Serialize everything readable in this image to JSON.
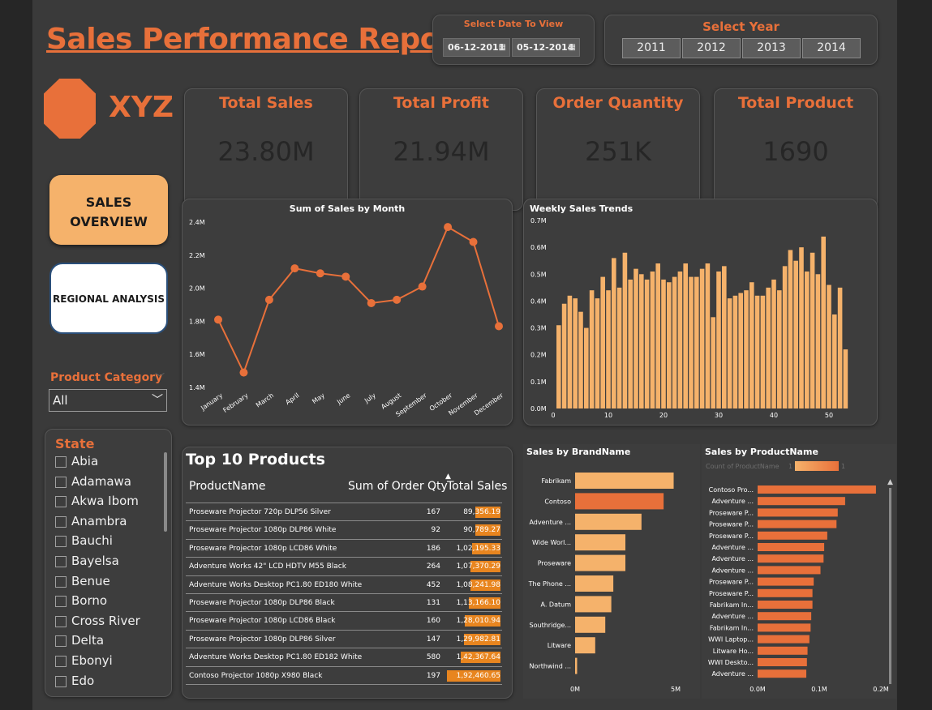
{
  "title": "Sales Performance Report",
  "date_filter": {
    "label": "Select Date To View",
    "start": "06-12-2011",
    "end": "05-12-2014"
  },
  "year_filter": {
    "label": "Select Year",
    "years": [
      "2011",
      "2012",
      "2013",
      "2014"
    ]
  },
  "logo": {
    "text": "XYZ"
  },
  "kpis": [
    {
      "title": "Total Sales",
      "value": "23.80M"
    },
    {
      "title": "Total Profit",
      "value": "21.94M"
    },
    {
      "title": "Order Quantity",
      "value": "251K"
    },
    {
      "title": "Total Product",
      "value": "1690"
    }
  ],
  "nav": {
    "sales_overview_line1": "SALES",
    "sales_overview_line2": "OVERVIEW",
    "regional_analysis": "REGIONAL ANALYSIS"
  },
  "product_category": {
    "label": "Product Category",
    "selected": "All"
  },
  "state_filter": {
    "label": "State",
    "items": [
      "Abia",
      "Adamawa",
      "Akwa Ibom",
      "Anambra",
      "Bauchi",
      "Bayelsa",
      "Benue",
      "Borno",
      "Cross River",
      "Delta",
      "Ebonyi",
      "Edo"
    ]
  },
  "colors": {
    "accent": "#e8703a",
    "bar_light": "#f5b26b",
    "highlight": "#e8851f",
    "background": "#3a3a3a"
  },
  "chart_data": [
    {
      "type": "line",
      "title": "Sum of Sales by Month",
      "categories": [
        "January",
        "February",
        "March",
        "April",
        "May",
        "June",
        "July",
        "August",
        "September",
        "October",
        "November",
        "December"
      ],
      "values": [
        1.81,
        1.49,
        1.93,
        2.12,
        2.09,
        2.07,
        1.91,
        1.93,
        2.01,
        2.37,
        2.28,
        1.77
      ],
      "unit": "M",
      "ylim": [
        1.4,
        2.4
      ],
      "yticks": [
        "1.4M",
        "1.6M",
        "1.8M",
        "2.0M",
        "2.2M",
        "2.4M"
      ]
    },
    {
      "type": "bar",
      "title": "Weekly Sales Trends",
      "x": [
        1,
        2,
        3,
        4,
        5,
        6,
        7,
        8,
        9,
        10,
        11,
        12,
        13,
        14,
        15,
        16,
        17,
        18,
        19,
        20,
        21,
        22,
        23,
        24,
        25,
        26,
        27,
        28,
        29,
        30,
        31,
        32,
        33,
        34,
        35,
        36,
        37,
        38,
        39,
        40,
        41,
        42,
        43,
        44,
        45,
        46,
        47,
        48,
        49,
        50,
        51,
        52,
        53
      ],
      "values": [
        0.31,
        0.39,
        0.42,
        0.41,
        0.36,
        0.3,
        0.44,
        0.41,
        0.49,
        0.44,
        0.56,
        0.45,
        0.58,
        0.48,
        0.52,
        0.5,
        0.48,
        0.51,
        0.54,
        0.48,
        0.47,
        0.49,
        0.51,
        0.54,
        0.49,
        0.49,
        0.52,
        0.54,
        0.34,
        0.51,
        0.53,
        0.41,
        0.42,
        0.43,
        0.44,
        0.47,
        0.42,
        0.42,
        0.45,
        0.48,
        0.44,
        0.53,
        0.59,
        0.55,
        0.6,
        0.51,
        0.58,
        0.5,
        0.64,
        0.46,
        0.35,
        0.45,
        0.22
      ],
      "unit": "M",
      "ylim": [
        0,
        0.7
      ],
      "yticks": [
        "0.0M",
        "0.1M",
        "0.2M",
        "0.3M",
        "0.4M",
        "0.5M",
        "0.6M",
        "0.7M"
      ],
      "xticks": [
        "0",
        "10",
        "20",
        "30",
        "40",
        "50"
      ]
    },
    {
      "type": "table",
      "title": "Top 10 Products",
      "columns": [
        "ProductName",
        "Sum of Order Qty",
        "Total Sales"
      ],
      "rows": [
        {
          "product": "Proseware Projector 720p DLP56 Silver",
          "qty": "167",
          "sales": "89,356.19",
          "value": 89356.19
        },
        {
          "product": "Proseware Projector 1080p DLP86 White",
          "qty": "92",
          "sales": "90,789.27",
          "value": 90789.27
        },
        {
          "product": "Proseware Projector 1080p LCD86 White",
          "qty": "186",
          "sales": "1,02,195.33",
          "value": 102195.33
        },
        {
          "product": "Adventure Works 42\" LCD HDTV M55 Black",
          "qty": "264",
          "sales": "1,07,370.29",
          "value": 107370.29
        },
        {
          "product": "Adventure Works Desktop PC1.80 ED180 White",
          "qty": "452",
          "sales": "1,08,241.98",
          "value": 108241.98
        },
        {
          "product": "Proseware Projector 1080p DLP86 Black",
          "qty": "131",
          "sales": "1,13,166.10",
          "value": 113166.1
        },
        {
          "product": "Proseware Projector 1080p LCD86 Black",
          "qty": "160",
          "sales": "1,28,010.94",
          "value": 128010.94
        },
        {
          "product": "Proseware Projector 1080p DLP86 Silver",
          "qty": "147",
          "sales": "1,29,982.81",
          "value": 129982.81
        },
        {
          "product": "Adventure Works Desktop PC1.80 ED182 White",
          "qty": "580",
          "sales": "1,42,367.64",
          "value": 142367.64
        },
        {
          "product": "Contoso Projector 1080p X980 Black",
          "qty": "197",
          "sales": "1,92,460.65",
          "value": 192460.65
        }
      ]
    },
    {
      "type": "bar",
      "title": "Sales by BrandName",
      "orientation": "horizontal",
      "categories": [
        "Fabrikam",
        "Contoso",
        "Adventure ...",
        "Wide Worl...",
        "Proseware",
        "The Phone ...",
        "A. Datum",
        "Southridge...",
        "Litware",
        "Northwind ..."
      ],
      "values": [
        4.9,
        4.4,
        3.3,
        2.5,
        2.5,
        1.9,
        1.8,
        1.5,
        1.0,
        0.1
      ],
      "unit": "M",
      "xlim": [
        0,
        5
      ],
      "xticks": [
        "0M",
        "5M"
      ]
    },
    {
      "type": "bar",
      "title": "Sales by ProductName",
      "orientation": "horizontal",
      "legend": "Count of ProductName",
      "legend_min": "1",
      "legend_max": "1",
      "categories": [
        "Contoso Pro...",
        "Adventure ...",
        "Proseware P...",
        "Proseware P...",
        "Proseware P...",
        "Adventure ...",
        "Adventure ...",
        "Adventure ...",
        "Proseware P...",
        "Proseware P...",
        "Fabrikam In...",
        "Adventure ...",
        "Fabrikam In...",
        "WWI Laptop...",
        "Litware Ho...",
        "WWI Deskto...",
        "Adventure ..."
      ],
      "values": [
        0.192,
        0.142,
        0.13,
        0.128,
        0.113,
        0.108,
        0.107,
        0.102,
        0.091,
        0.089,
        0.089,
        0.087,
        0.086,
        0.084,
        0.081,
        0.08,
        0.079
      ],
      "unit": "M",
      "xlim": [
        0,
        0.2
      ],
      "xticks": [
        "0.0M",
        "0.1M",
        "0.2M"
      ]
    }
  ]
}
